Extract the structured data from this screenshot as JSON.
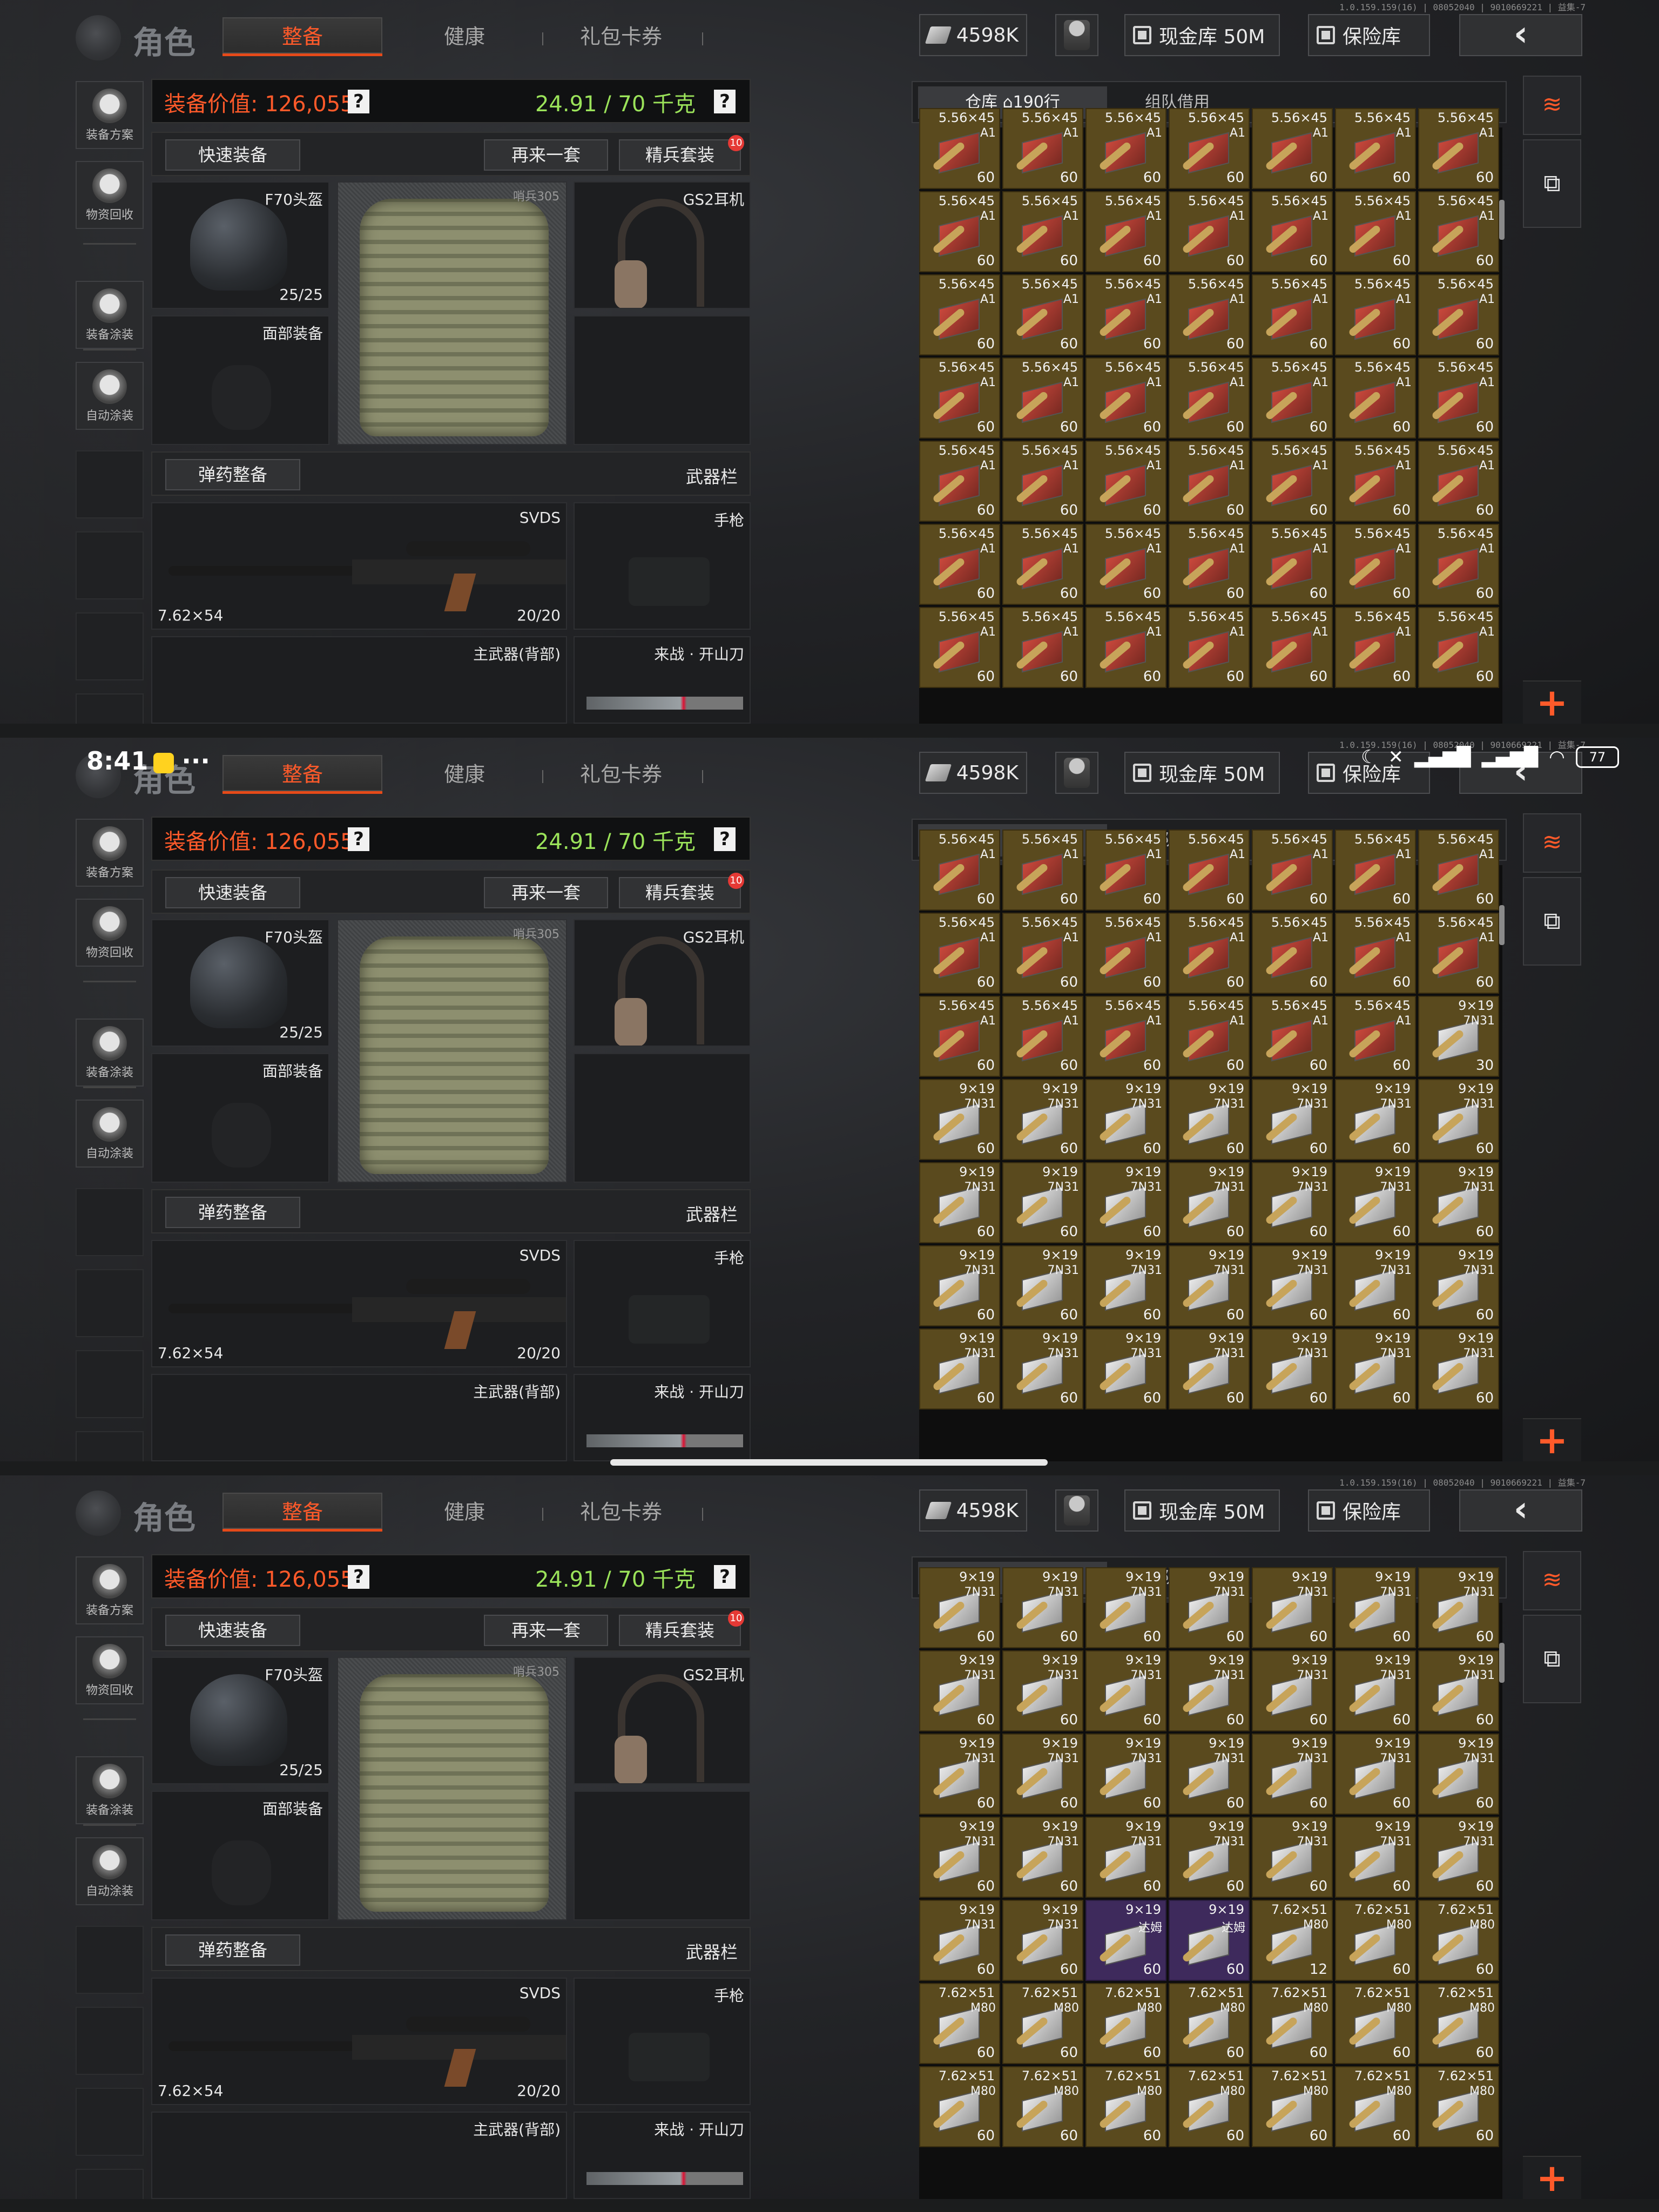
{
  "version_text": "1.0.159.159(16) | 08052040 | 9010669221 | 益集-7",
  "header": {
    "title": "角色",
    "tabs": [
      "整备",
      "健康",
      "礼包卡券"
    ],
    "cash": "4598K",
    "vault": "现金库 50M",
    "safebox": "保险库",
    "back_icon": "chevron-left-icon"
  },
  "sidebar": {
    "items": [
      "装备方案",
      "物资回收",
      "装备涂装",
      "自动涂装"
    ]
  },
  "loadout": {
    "value_label": "装备价值: 126,055",
    "weight": "24.91 / 70 千克",
    "help": "?",
    "quick_equip": "快速装备",
    "again": "再来一套",
    "elite_set": "精兵套装",
    "elite_badge": "10",
    "helmet_name": "F70头盔",
    "helmet_dur": "25/25",
    "vest_tag": "哨兵305",
    "headset_name": "GS2耳机",
    "face_label": "面部装备",
    "ammo_btn": "弹药整备",
    "weapon_bar": "武器栏",
    "rifle_name": "SVDS",
    "rifle_caliber": "7.62×54",
    "rifle_ammo": "20/20",
    "pistol_label": "手枪",
    "main_back": "主武器(背部)",
    "melee": "来战 · 开山刀"
  },
  "inventory": {
    "tab_warehouse": "仓库",
    "tab_rows": "190行",
    "tab_team": "组队借用",
    "panels": [
      {
        "rows": [
          [
            [
              "5.56×45",
              "A1",
              "60"
            ],
            [
              "5.56×45",
              "A1",
              "60"
            ],
            [
              "5.56×45",
              "A1",
              "60"
            ],
            [
              "5.56×45",
              "A1",
              "60"
            ],
            [
              "5.56×45",
              "A1",
              "60"
            ],
            [
              "5.56×45",
              "A1",
              "60"
            ],
            [
              "5.56×45",
              "A1",
              "60"
            ]
          ],
          [
            [
              "5.56×45",
              "A1",
              "60"
            ],
            [
              "5.56×45",
              "A1",
              "60"
            ],
            [
              "5.56×45",
              "A1",
              "60"
            ],
            [
              "5.56×45",
              "A1",
              "60"
            ],
            [
              "5.56×45",
              "A1",
              "60"
            ],
            [
              "5.56×45",
              "A1",
              "60"
            ],
            [
              "5.56×45",
              "A1",
              "60"
            ]
          ],
          [
            [
              "5.56×45",
              "A1",
              "60"
            ],
            [
              "5.56×45",
              "A1",
              "60"
            ],
            [
              "5.56×45",
              "A1",
              "60"
            ],
            [
              "5.56×45",
              "A1",
              "60"
            ],
            [
              "5.56×45",
              "A1",
              "60"
            ],
            [
              "5.56×45",
              "A1",
              "60"
            ],
            [
              "5.56×45",
              "A1",
              "60"
            ]
          ],
          [
            [
              "5.56×45",
              "A1",
              "60"
            ],
            [
              "5.56×45",
              "A1",
              "60"
            ],
            [
              "5.56×45",
              "A1",
              "60"
            ],
            [
              "5.56×45",
              "A1",
              "60"
            ],
            [
              "5.56×45",
              "A1",
              "60"
            ],
            [
              "5.56×45",
              "A1",
              "60"
            ],
            [
              "5.56×45",
              "A1",
              "60"
            ]
          ],
          [
            [
              "5.56×45",
              "A1",
              "60"
            ],
            [
              "5.56×45",
              "A1",
              "60"
            ],
            [
              "5.56×45",
              "A1",
              "60"
            ],
            [
              "5.56×45",
              "A1",
              "60"
            ],
            [
              "5.56×45",
              "A1",
              "60"
            ],
            [
              "5.56×45",
              "A1",
              "60"
            ],
            [
              "5.56×45",
              "A1",
              "60"
            ]
          ],
          [
            [
              "5.56×45",
              "A1",
              "60"
            ],
            [
              "5.56×45",
              "A1",
              "60"
            ],
            [
              "5.56×45",
              "A1",
              "60"
            ],
            [
              "5.56×45",
              "A1",
              "60"
            ],
            [
              "5.56×45",
              "A1",
              "60"
            ],
            [
              "5.56×45",
              "A1",
              "60"
            ],
            [
              "5.56×45",
              "A1",
              "60"
            ]
          ],
          [
            [
              "5.56×45",
              "A1",
              "60"
            ],
            [
              "5.56×45",
              "A1",
              "60"
            ],
            [
              "5.56×45",
              "A1",
              "60"
            ],
            [
              "5.56×45",
              "A1",
              "60"
            ],
            [
              "5.56×45",
              "A1",
              "60"
            ],
            [
              "5.56×45",
              "A1",
              "60"
            ],
            [
              "5.56×45",
              "A1",
              "60"
            ]
          ]
        ]
      },
      {
        "rows": [
          [
            [
              "5.56×45",
              "A1",
              "60"
            ],
            [
              "5.56×45",
              "A1",
              "60"
            ],
            [
              "5.56×45",
              "A1",
              "60"
            ],
            [
              "5.56×45",
              "A1",
              "60"
            ],
            [
              "5.56×45",
              "A1",
              "60"
            ],
            [
              "5.56×45",
              "A1",
              "60"
            ],
            [
              "5.56×45",
              "A1",
              "60"
            ]
          ],
          [
            [
              "5.56×45",
              "A1",
              "60"
            ],
            [
              "5.56×45",
              "A1",
              "60"
            ],
            [
              "5.56×45",
              "A1",
              "60"
            ],
            [
              "5.56×45",
              "A1",
              "60"
            ],
            [
              "5.56×45",
              "A1",
              "60"
            ],
            [
              "5.56×45",
              "A1",
              "60"
            ],
            [
              "5.56×45",
              "A1",
              "60"
            ]
          ],
          [
            [
              "5.56×45",
              "A1",
              "60"
            ],
            [
              "5.56×45",
              "A1",
              "60"
            ],
            [
              "5.56×45",
              "A1",
              "60"
            ],
            [
              "5.56×45",
              "A1",
              "60"
            ],
            [
              "5.56×45",
              "A1",
              "60"
            ],
            [
              "5.56×45",
              "A1",
              "60"
            ],
            [
              "9×19",
              "7N31",
              "30"
            ]
          ],
          [
            [
              "9×19",
              "7N31",
              "60"
            ],
            [
              "9×19",
              "7N31",
              "60"
            ],
            [
              "9×19",
              "7N31",
              "60"
            ],
            [
              "9×19",
              "7N31",
              "60"
            ],
            [
              "9×19",
              "7N31",
              "60"
            ],
            [
              "9×19",
              "7N31",
              "60"
            ],
            [
              "9×19",
              "7N31",
              "60"
            ]
          ],
          [
            [
              "9×19",
              "7N31",
              "60"
            ],
            [
              "9×19",
              "7N31",
              "60"
            ],
            [
              "9×19",
              "7N31",
              "60"
            ],
            [
              "9×19",
              "7N31",
              "60"
            ],
            [
              "9×19",
              "7N31",
              "60"
            ],
            [
              "9×19",
              "7N31",
              "60"
            ],
            [
              "9×19",
              "7N31",
              "60"
            ]
          ],
          [
            [
              "9×19",
              "7N31",
              "60"
            ],
            [
              "9×19",
              "7N31",
              "60"
            ],
            [
              "9×19",
              "7N31",
              "60"
            ],
            [
              "9×19",
              "7N31",
              "60"
            ],
            [
              "9×19",
              "7N31",
              "60"
            ],
            [
              "9×19",
              "7N31",
              "60"
            ],
            [
              "9×19",
              "7N31",
              "60"
            ]
          ],
          [
            [
              "9×19",
              "7N31",
              "60"
            ],
            [
              "9×19",
              "7N31",
              "60"
            ],
            [
              "9×19",
              "7N31",
              "60"
            ],
            [
              "9×19",
              "7N31",
              "60"
            ],
            [
              "9×19",
              "7N31",
              "60"
            ],
            [
              "9×19",
              "7N31",
              "60"
            ],
            [
              "9×19",
              "7N31",
              "60"
            ]
          ]
        ]
      },
      {
        "rows": [
          [
            [
              "9×19",
              "7N31",
              "60"
            ],
            [
              "9×19",
              "7N31",
              "60"
            ],
            [
              "9×19",
              "7N31",
              "60"
            ],
            [
              "9×19",
              "7N31",
              "60"
            ],
            [
              "9×19",
              "7N31",
              "60"
            ],
            [
              "9×19",
              "7N31",
              "60"
            ],
            [
              "9×19",
              "7N31",
              "60"
            ]
          ],
          [
            [
              "9×19",
              "7N31",
              "60"
            ],
            [
              "9×19",
              "7N31",
              "60"
            ],
            [
              "9×19",
              "7N31",
              "60"
            ],
            [
              "9×19",
              "7N31",
              "60"
            ],
            [
              "9×19",
              "7N31",
              "60"
            ],
            [
              "9×19",
              "7N31",
              "60"
            ],
            [
              "9×19",
              "7N31",
              "60"
            ]
          ],
          [
            [
              "9×19",
              "7N31",
              "60"
            ],
            [
              "9×19",
              "7N31",
              "60"
            ],
            [
              "9×19",
              "7N31",
              "60"
            ],
            [
              "9×19",
              "7N31",
              "60"
            ],
            [
              "9×19",
              "7N31",
              "60"
            ],
            [
              "9×19",
              "7N31",
              "60"
            ],
            [
              "9×19",
              "7N31",
              "60"
            ]
          ],
          [
            [
              "9×19",
              "7N31",
              "60"
            ],
            [
              "9×19",
              "7N31",
              "60"
            ],
            [
              "9×19",
              "7N31",
              "60"
            ],
            [
              "9×19",
              "7N31",
              "60"
            ],
            [
              "9×19",
              "7N31",
              "60"
            ],
            [
              "9×19",
              "7N31",
              "60"
            ],
            [
              "9×19",
              "7N31",
              "60"
            ]
          ],
          [
            [
              "9×19",
              "7N31",
              "60"
            ],
            [
              "9×19",
              "7N31",
              "60"
            ],
            [
              "9×19",
              "达姆",
              "60",
              "purple"
            ],
            [
              "9×19",
              "达姆",
              "60",
              "purple"
            ],
            [
              "7.62×51",
              "M80",
              "12"
            ],
            [
              "7.62×51",
              "M80",
              "60"
            ],
            [
              "7.62×51",
              "M80",
              "60"
            ]
          ],
          [
            [
              "7.62×51",
              "M80",
              "60"
            ],
            [
              "7.62×51",
              "M80",
              "60"
            ],
            [
              "7.62×51",
              "M80",
              "60"
            ],
            [
              "7.62×51",
              "M80",
              "60"
            ],
            [
              "7.62×51",
              "M80",
              "60"
            ],
            [
              "7.62×51",
              "M80",
              "60"
            ],
            [
              "7.62×51",
              "M80",
              "60"
            ]
          ],
          [
            [
              "7.62×51",
              "M80",
              "60"
            ],
            [
              "7.62×51",
              "M80",
              "60"
            ],
            [
              "7.62×51",
              "M80",
              "60"
            ],
            [
              "7.62×51",
              "M80",
              "60"
            ],
            [
              "7.62×51",
              "M80",
              "60"
            ],
            [
              "7.62×51",
              "M80",
              "60"
            ],
            [
              "7.62×51",
              "M80",
              "60"
            ]
          ]
        ]
      }
    ]
  },
  "right_rail": {
    "plus": "+"
  },
  "phone_status": {
    "time": "8:41",
    "dots": "···",
    "battery": "77"
  }
}
